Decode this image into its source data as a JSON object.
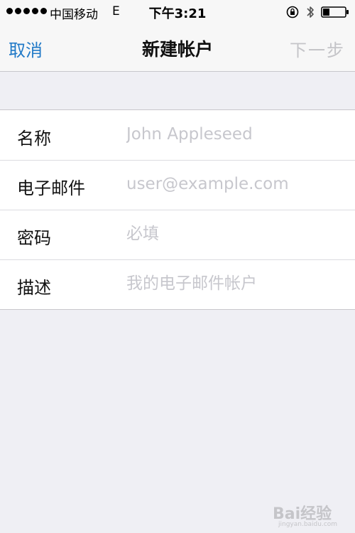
{
  "status_bar": {
    "carrier": "中国移动",
    "network": "E",
    "time": "下午3:21",
    "signal_bars": 5,
    "icons": [
      "signal-dots-icon",
      "rotation-lock-icon",
      "bluetooth-icon",
      "battery-icon"
    ],
    "battery_level": 0.3
  },
  "nav": {
    "cancel_label": "取消",
    "title": "新建帐户",
    "next_label": "下一步",
    "accent_color": "#2079c7",
    "disabled_color": "#c4c4c8"
  },
  "form": {
    "rows": [
      {
        "label": "名称",
        "placeholder": "John Appleseed",
        "value": ""
      },
      {
        "label": "电子邮件",
        "placeholder": "user@example.com",
        "value": ""
      },
      {
        "label": "密码",
        "placeholder": "必填",
        "value": ""
      },
      {
        "label": "描述",
        "placeholder": "我的电子邮件帐户",
        "value": ""
      }
    ]
  },
  "watermark": {
    "text": "Bai经验",
    "sub": "jingyan.baidu.com"
  }
}
